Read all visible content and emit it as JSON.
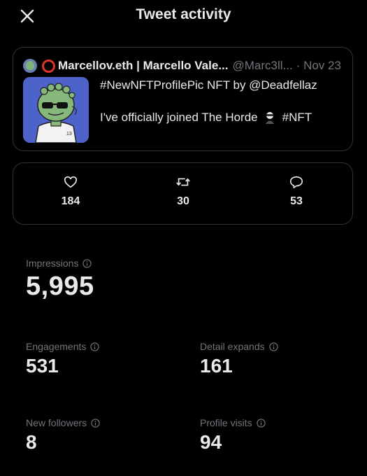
{
  "header": {
    "title": "Tweet activity"
  },
  "tweet": {
    "author_name": "Marcellov.eth | Marcello Vale...",
    "author_handle": "@Marc3ll...",
    "date": "· Nov 23",
    "line1": "#NewNFTProfilePic NFT by @Deadfellaz",
    "line2_text": "I've officially joined The Horde",
    "line2_hashtag": "#NFT",
    "image_number": "13"
  },
  "metrics": {
    "likes": "184",
    "retweets": "30",
    "replies": "53"
  },
  "stats": {
    "impressions": {
      "label": "Impressions",
      "value": "5,995"
    },
    "engagements": {
      "label": "Engagements",
      "value": "531"
    },
    "detail_expands": {
      "label": "Detail expands",
      "value": "161"
    },
    "new_followers": {
      "label": "New followers",
      "value": "8"
    },
    "profile_visits": {
      "label": "Profile visits",
      "value": "94"
    }
  },
  "colors": {
    "background": "#000000",
    "text": "#e7e9ea",
    "muted": "#71767b",
    "border": "#2f3336"
  },
  "icons": [
    "close-icon",
    "heart-icon",
    "retweet-icon",
    "reply-icon",
    "info-icon"
  ]
}
